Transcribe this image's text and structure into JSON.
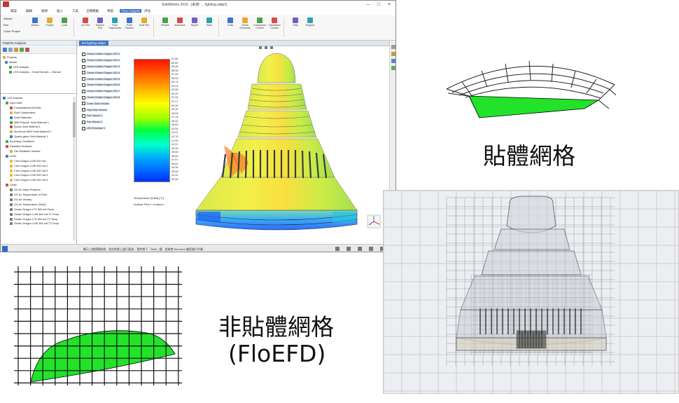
{
  "window": {
    "title": "SolidWorks 2016 - [系統: ... lighting.sldprt]",
    "menus": [
      "檔案",
      "編輯",
      "檢視",
      "插入",
      "工具",
      "全模模擬",
      "視窗",
      "說明",
      "Flow Analysis",
      "評估"
    ],
    "active_menu": "Flow Analysis"
  },
  "ribbon": {
    "left_items": [
      "Wizard",
      "Run",
      "Clone Project"
    ],
    "buttons": [
      "Wizard",
      "Project",
      "Load",
      "Cut Plot",
      "Surface Plot",
      "Flow Trajectories",
      "Point Params",
      "Goal Plot",
      "Results",
      "Animation",
      "Report",
      "Save",
      "Tools",
      "Check Geometry",
      "Component Control",
      "Calculation Control",
      "Help",
      "Support"
    ]
  },
  "left_panel": {
    "title": "FloEFD Analysis",
    "projects_header": "Projects",
    "tree_top": [
      "Projects",
      "Master",
      "LED Analysis",
      "LED Analysis -- Small Domain -- Manual"
    ],
    "tree_bottom": [
      "LED Analysis",
      "Input Data",
      "Computational Domain",
      "Fluid Subdomains",
      "Solid Materials",
      "ABS Polymer Solid Material 1",
      "Epoxy Solid Material 1",
      "Aluminum 6063 Solid Material 1",
      "Quartz glass Solid Material 1",
      "Boundary Conditions",
      "Radiative Surfaces",
      "Fan Radiative Surface",
      "LEDs",
      "Cree Dragon LUW 500 mA",
      "Cree Dragon LUW 500 mA 2",
      "Cree Dragon LUW 500 mA 3",
      "Cree Dragon LUW 500 mA 4",
      "Cree Dragon LUW 500 mA 5",
      "Goals",
      "GG Av Static Pressure",
      "GG Av Temperature of Fluid",
      "GG Av Velocity",
      "GG Av Temperature (Solid)",
      "Osram Dragon LTS 500 mA Temp",
      "Osram Dragon LUW 500 mA T1 Temp",
      "Osram Dragon LTS 500 mA T2 Temp",
      "Osram Dragon LUW 500 mA T3 Temp"
    ]
  },
  "viewport": {
    "tab": "led lighting.sldprt",
    "colorbar_ticks": [
      "61.50",
      "60.82",
      "59.48",
      "58.08",
      "57.32",
      "56.03",
      "55.74",
      "54.04",
      "53.56",
      "52.49",
      "51.94",
      "51.17",
      "50.39",
      "49.32",
      "48.93",
      "47.14",
      "46.32",
      "45.63",
      "44.54",
      "43.91",
      "42.76",
      "41.90",
      "41.01",
      "40.35",
      "39.60",
      "38.89",
      "37.67",
      "36.81",
      "35.95",
      "35.06",
      "34.31",
      "33.45"
    ],
    "colorbar_title": "Temperature (Solid) [°C]",
    "colorbar_subtitle": "Surface Plot 1: contours",
    "legend_items": [
      "Osram Golden Dragon LED 1",
      "Osram Golden Dragon LED 2",
      "Osram Golden Dragon LED 3",
      "Osram Golden Dragon LED 4",
      "Osram Golden Dragon LED 5",
      "Osram Golden Dragon LED 6",
      "Osram Golden Dragon LED 7",
      "Osram Golden Dragon LED 8",
      "Cover Solid Volume",
      "Heat Sink Volume",
      "Fan Volume 1",
      "Fan Volume 2",
      "LED Envelope 1"
    ]
  },
  "statusbar": {
    "text": "顯示三維模擬結果，並在結果上進行量測... 暫時按下「Shift」鍵，並拖曳 Windows 檔案進行作業..."
  },
  "labels": {
    "body_fitted": "貼體網格",
    "non_body_fitted": "非貼體網格",
    "floefd": "(FloEFD)"
  },
  "colors": {
    "mesh_fill": "#22e22a",
    "ribbon_active": "#2b6cc4"
  }
}
